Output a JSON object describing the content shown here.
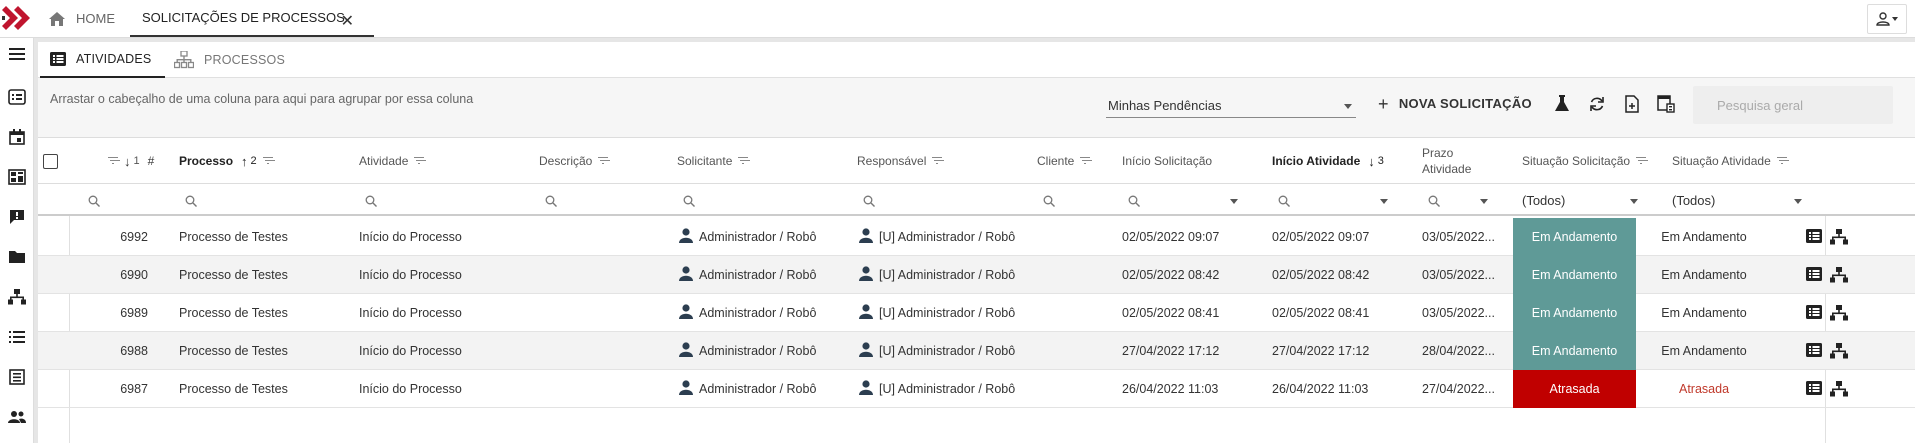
{
  "topbar": {
    "home_label": "HOME",
    "active_tab_label": "SOLICITAÇÕES DE PROCESSOS",
    "close_symbol": "✕"
  },
  "subtabs": {
    "activities": "ATIVIDADES",
    "processes": "PROCESSOS"
  },
  "toolbar": {
    "group_hint": "Arrastar o cabeçalho de uma coluna para aqui para agrupar por essa coluna",
    "filter_value": "Minhas Pendências",
    "new_button": "NOVA SOLICITAÇÃO",
    "search_placeholder": "Pesquisa geral"
  },
  "columns": {
    "id": "#",
    "id_sort": "1",
    "process": "Processo",
    "process_sort": "2",
    "activity": "Atividade",
    "description": "Descrição",
    "requester": "Solicitante",
    "responsible": "Responsável",
    "client": "Cliente",
    "request_start": "Início Solicitação",
    "activity_start": "Início Atividade",
    "activity_start_sort": "3",
    "deadline_line1": "Prazo",
    "deadline_line2": "Atividade",
    "request_status": "Situação Solicitação",
    "activity_status": "Situação Atividade"
  },
  "filters": {
    "request_status": "(Todos)",
    "activity_status": "(Todos)"
  },
  "colors": {
    "in_progress": "#5f9a97",
    "late": "#c00000",
    "late_text": "#c0392b"
  },
  "rows": [
    {
      "id": "6992",
      "process": "Processo de Testes",
      "activity": "Início do Processo",
      "requester": "Administrador / Robô",
      "responsible": "[U] Administrador / Robô",
      "request_start": "02/05/2022 09:07",
      "activity_start": "02/05/2022 09:07",
      "deadline": "03/05/2022...",
      "request_status": "Em Andamento",
      "activity_status": "Em Andamento"
    },
    {
      "id": "6990",
      "process": "Processo de Testes",
      "activity": "Início do Processo",
      "requester": "Administrador / Robô",
      "responsible": "[U] Administrador / Robô",
      "request_start": "02/05/2022 08:42",
      "activity_start": "02/05/2022 08:42",
      "deadline": "03/05/2022...",
      "request_status": "Em Andamento",
      "activity_status": "Em Andamento"
    },
    {
      "id": "6989",
      "process": "Processo de Testes",
      "activity": "Início do Processo",
      "requester": "Administrador / Robô",
      "responsible": "[U] Administrador / Robô",
      "request_start": "02/05/2022 08:41",
      "activity_start": "02/05/2022 08:41",
      "deadline": "03/05/2022...",
      "request_status": "Em Andamento",
      "activity_status": "Em Andamento"
    },
    {
      "id": "6988",
      "process": "Processo de Testes",
      "activity": "Início do Processo",
      "requester": "Administrador / Robô",
      "responsible": "[U] Administrador / Robô",
      "request_start": "27/04/2022 17:12",
      "activity_start": "27/04/2022 17:12",
      "deadline": "28/04/2022...",
      "request_status": "Em Andamento",
      "activity_status": "Em Andamento"
    },
    {
      "id": "6987",
      "process": "Processo de Testes",
      "activity": "Início do Processo",
      "requester": "Administrador / Robô",
      "responsible": "[U] Administrador / Robô",
      "request_start": "26/04/2022 11:03",
      "activity_start": "26/04/2022 11:03",
      "deadline": "27/04/2022...",
      "request_status": "Atrasada",
      "activity_status": "Atrasada"
    }
  ]
}
